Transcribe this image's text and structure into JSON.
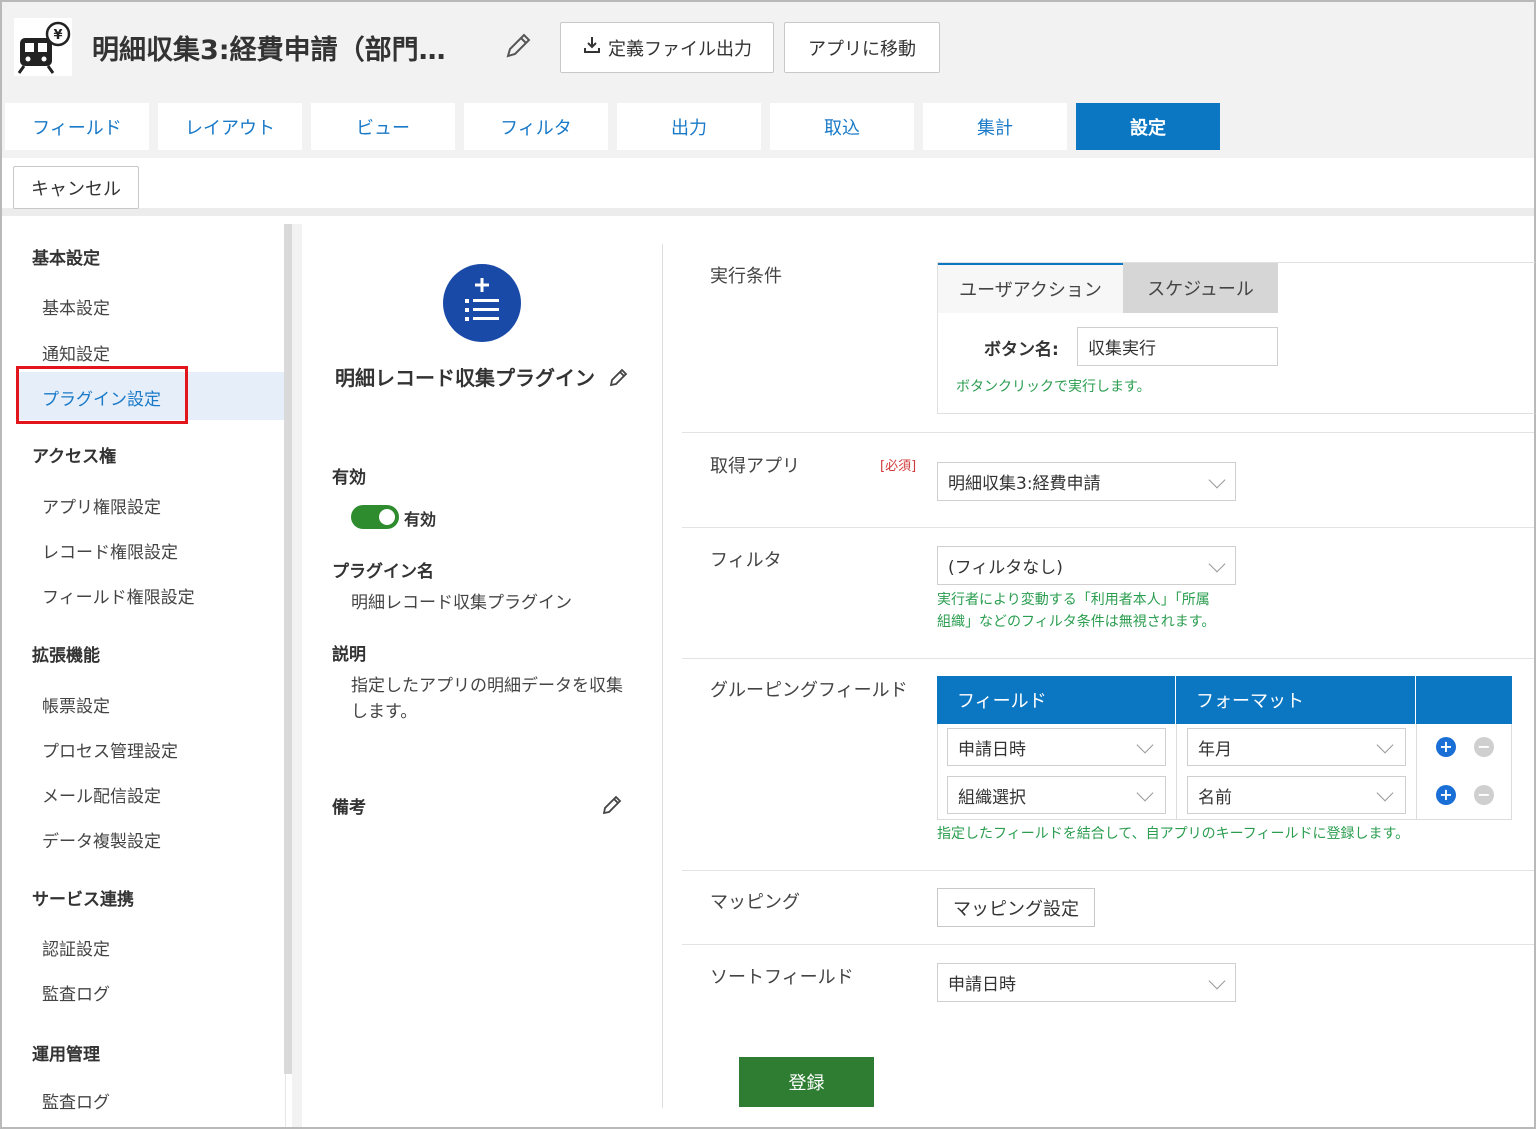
{
  "header": {
    "title": "明細収集3:経費申請（部門…",
    "export_label": "定義ファイル出力",
    "goto_app_label": "アプリに移動"
  },
  "tabs": [
    {
      "label": "フィールド"
    },
    {
      "label": "レイアウト"
    },
    {
      "label": "ビュー"
    },
    {
      "label": "フィルタ"
    },
    {
      "label": "出力"
    },
    {
      "label": "取込"
    },
    {
      "label": "集計"
    },
    {
      "label": "設定",
      "active": true
    }
  ],
  "toolbar": {
    "cancel_label": "キャンセル"
  },
  "sidebar": {
    "sections": [
      {
        "title": "基本設定",
        "items": [
          "基本設定",
          "通知設定",
          "プラグイン設定"
        ]
      },
      {
        "title": "アクセス権",
        "items": [
          "アプリ権限設定",
          "レコード権限設定",
          "フィールド権限設定"
        ]
      },
      {
        "title": "拡張機能",
        "items": [
          "帳票設定",
          "プロセス管理設定",
          "メール配信設定",
          "データ複製設定"
        ]
      },
      {
        "title": "サービス連携",
        "items": [
          "認証設定",
          "監査ログ"
        ]
      },
      {
        "title": "運用管理",
        "items": [
          "監査ログ"
        ]
      }
    ],
    "active_item": "プラグイン設定"
  },
  "plugin": {
    "name": "明細レコード収集プラグイン",
    "enabled_label": "有効",
    "toggle_label": "有効",
    "toggle_on": true,
    "name_label": "プラグイン名",
    "name_value": "明細レコード収集プラグイン",
    "desc_label": "説明",
    "desc_line1": "指定したアプリの明細データを収集",
    "desc_line2": "します。",
    "remarks_label": "備考"
  },
  "settings": {
    "exec_label": "実行条件",
    "exec_tabs": [
      "ユーザアクション",
      "スケジュール"
    ],
    "button_name_label": "ボタン名:",
    "button_name_value": "収集実行",
    "button_note": "ボタンクリックで実行します。",
    "source_label": "取得アプリ",
    "required_badge": "[必須]",
    "source_value": "明細収集3:経費申請",
    "filter_label": "フィルタ",
    "filter_value": "(フィルタなし)",
    "filter_note1": "実行者により変動する「利用者本人」「所属",
    "filter_note2": "組織」などのフィルタ条件は無視されます。",
    "grouping_label": "グルーピングフィールド",
    "grouping_headers": [
      "フィールド",
      "フォーマット"
    ],
    "grouping_rows": [
      {
        "field": "申請日時",
        "format": "年月"
      },
      {
        "field": "組織選択",
        "format": "名前"
      }
    ],
    "grouping_note": "指定したフィールドを結合して、自アプリのキーフィールドに登録します。",
    "mapping_label": "マッピング",
    "mapping_button": "マッピング設定",
    "sort_label": "ソートフィールド",
    "sort_value": "申請日時",
    "submit_label": "登録"
  },
  "colors": {
    "accent": "#0b77c2",
    "submit": "#2e7d32",
    "note": "#2a9d4f",
    "highlight_outline": "#e2141c"
  }
}
